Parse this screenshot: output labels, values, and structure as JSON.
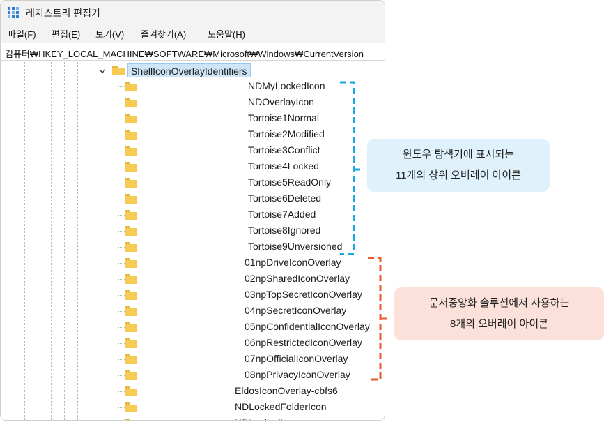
{
  "window": {
    "title": "레지스트리 편집기"
  },
  "menu": [
    "파일(F)",
    "편집(E)",
    "보기(V)",
    "즐겨찾기(A)",
    "도움말(H)"
  ],
  "address": "컴퓨터₩HKEY_LOCAL_MACHINE₩SOFTWARE₩Microsoft₩Windows₩CurrentVersion",
  "tree": {
    "selected_key": "ShellIconOverlayIdentifiers",
    "tortoise_items": [
      "NDMyLockedIcon",
      "NDOverlayIcon",
      "Tortoise1Normal",
      "Tortoise2Modified",
      "Tortoise3Conflict",
      "Tortoise4Locked",
      "Tortoise5ReadOnly",
      "Tortoise6Deleted",
      "Tortoise7Added",
      "Tortoise8Ignored",
      "Tortoise9Unversioned"
    ],
    "np_items": [
      "01npDriveIconOverlay",
      "02npSharedIconOverlay",
      "03npTopSecretIconOverlay",
      "04npSecretIconOverlay",
      "05npConfidentialIconOverlay",
      "06npRestrictedIconOverlay",
      "07npOfficialIconOverlay",
      "08npPrivacyIconOverlay"
    ],
    "other_items": [
      "EldosIconOverlay-cbfs6",
      "NDLockedFolderIcon",
      "NDLockedI..."
    ]
  },
  "callouts": {
    "explorer": {
      "line1": "윈도우 탐색기에 표시되는",
      "line2": "11개의 상위 오버레이 아이콘",
      "accent": "#1aa6e0"
    },
    "dlp": {
      "line1": "문서중앙화 솔루션에서 사용하는",
      "line2": "8개의 오버레이 아이콘",
      "accent": "#ee5a2f"
    }
  },
  "icons": {
    "app": "registry-editor-icon",
    "folder": "folder-icon",
    "expand": "chevron-down-icon"
  }
}
